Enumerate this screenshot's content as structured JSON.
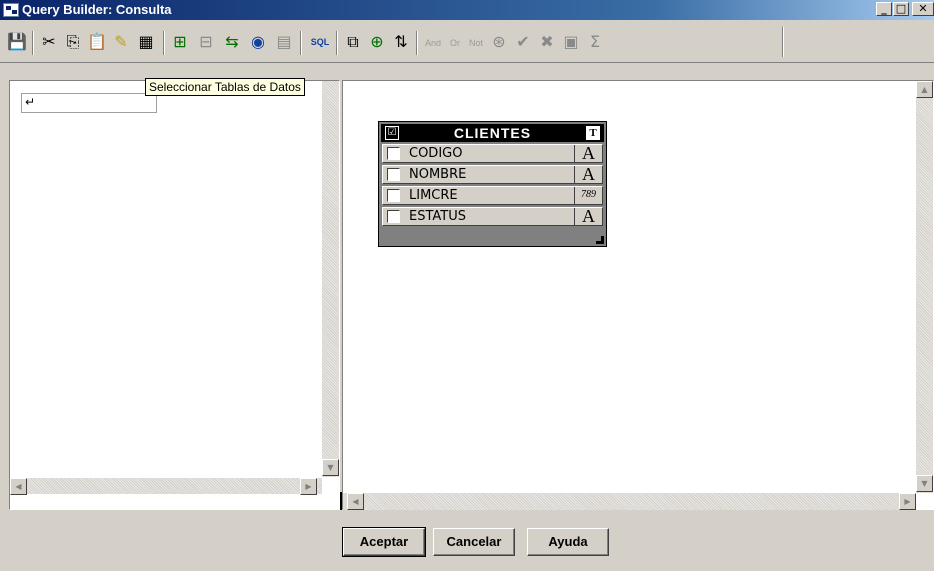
{
  "window": {
    "title": "Query Builder: Consulta",
    "caption_buttons": {
      "minimize": "_",
      "maximize": "□",
      "close": "✕"
    }
  },
  "toolbar": {
    "icons": [
      "save-icon",
      "cut-icon",
      "copy-icon",
      "paste-icon",
      "clear-icon",
      "select-grid-icon",
      "add-table-icon",
      "remove-table-icon",
      "join-icon",
      "view-icon",
      "grid-icon",
      "sql-icon",
      "add-column-icon",
      "add-expression-icon",
      "sort-icon",
      "and-icon",
      "or-icon",
      "not-icon",
      "and-or-icon",
      "check-icon",
      "delete-icon",
      "group-icon",
      "sum-icon"
    ],
    "logic_labels": {
      "and": "And",
      "or": "Or",
      "not": "Not",
      "sql": "SQL"
    },
    "tooltip": "Seleccionar Tablas de Datos"
  },
  "left_pane": {
    "editor_glyph": "↵"
  },
  "table": {
    "name": "CLIENTES",
    "header_check_glyph": "☑",
    "header_type_glyph": "T",
    "fields": [
      {
        "name": "CODIGO",
        "type_glyph": "A",
        "checked": false
      },
      {
        "name": "NOMBRE",
        "type_glyph": "A",
        "checked": false
      },
      {
        "name": "LIMCRE",
        "type_glyph": "789",
        "checked": false
      },
      {
        "name": "ESTATUS",
        "type_glyph": "A",
        "checked": false
      }
    ]
  },
  "buttons": {
    "accept": "Aceptar",
    "cancel": "Cancelar",
    "help": "Ayuda"
  }
}
